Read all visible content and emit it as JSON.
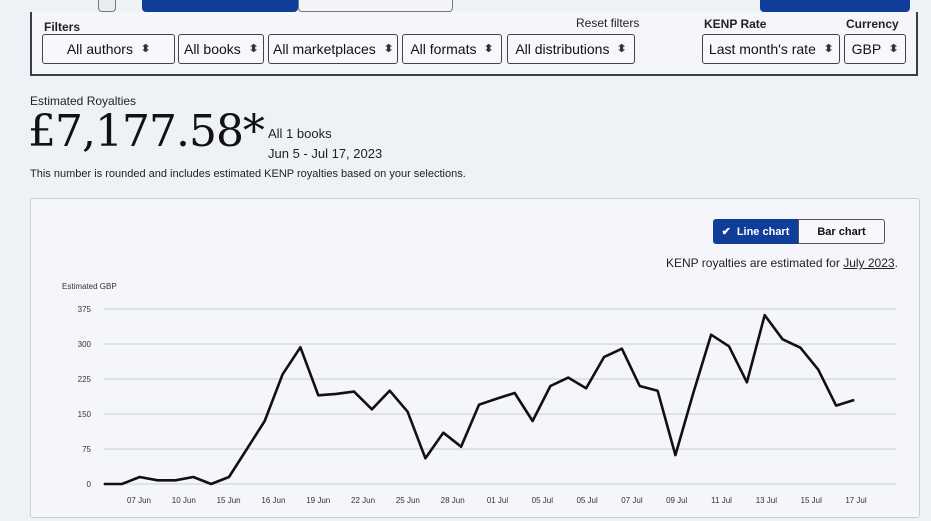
{
  "filters": {
    "label": "Filters",
    "reset_label": "Reset filters",
    "authors": "All authors",
    "books": "All books",
    "marketplaces": "All marketplaces",
    "formats": "All formats",
    "distributions": "All distributions",
    "kenp_rate_label": "KENP Rate",
    "kenp_rate": "Last month's rate",
    "currency_label": "Currency",
    "currency": "GBP"
  },
  "summary": {
    "label": "Estimated Royalties",
    "amount": "£7,177.58*",
    "books": "All 1 books",
    "date_range": "Jun 5 - Jul 17, 2023",
    "disclaimer": "This number is rounded and includes estimated KENP royalties based on your selections."
  },
  "chart_toggle": {
    "line_label": "Line chart",
    "bar_label": "Bar chart",
    "selected": "line"
  },
  "kenp_note": {
    "text": "KENP royalties are estimated for",
    "month": "July 2023",
    "suffix": "."
  },
  "colors": {
    "accent": "#0f3d99",
    "line": "#111111",
    "background": "#eef1f6"
  },
  "chart_data": {
    "type": "line",
    "ylabel": "Estimated GBP",
    "ylim": [
      0,
      375
    ],
    "yticks": [
      0,
      75,
      150,
      225,
      300,
      375
    ],
    "xtick_labels": [
      "07 Jun",
      "10 Jun",
      "15 Jun",
      "16 Jun",
      "19 Jun",
      "22 Jun",
      "25 Jun",
      "28 Jun",
      "01 Jul",
      "05 Jul",
      "05 Jul",
      "07 Jul",
      "09 Jul",
      "11 Jul",
      "13 Jul",
      "15 Jul",
      "17 Jul"
    ],
    "grid": true,
    "series": [
      {
        "values": [
          0,
          0,
          15,
          8,
          8,
          15,
          0,
          15,
          75,
          135,
          235,
          293,
          190,
          193,
          198,
          160,
          200,
          155,
          55,
          110,
          80,
          170,
          183,
          195,
          135,
          210,
          228,
          205,
          272,
          290,
          210,
          200,
          62,
          195,
          320,
          295,
          218,
          362,
          310,
          292,
          245,
          168,
          180
        ]
      }
    ]
  }
}
